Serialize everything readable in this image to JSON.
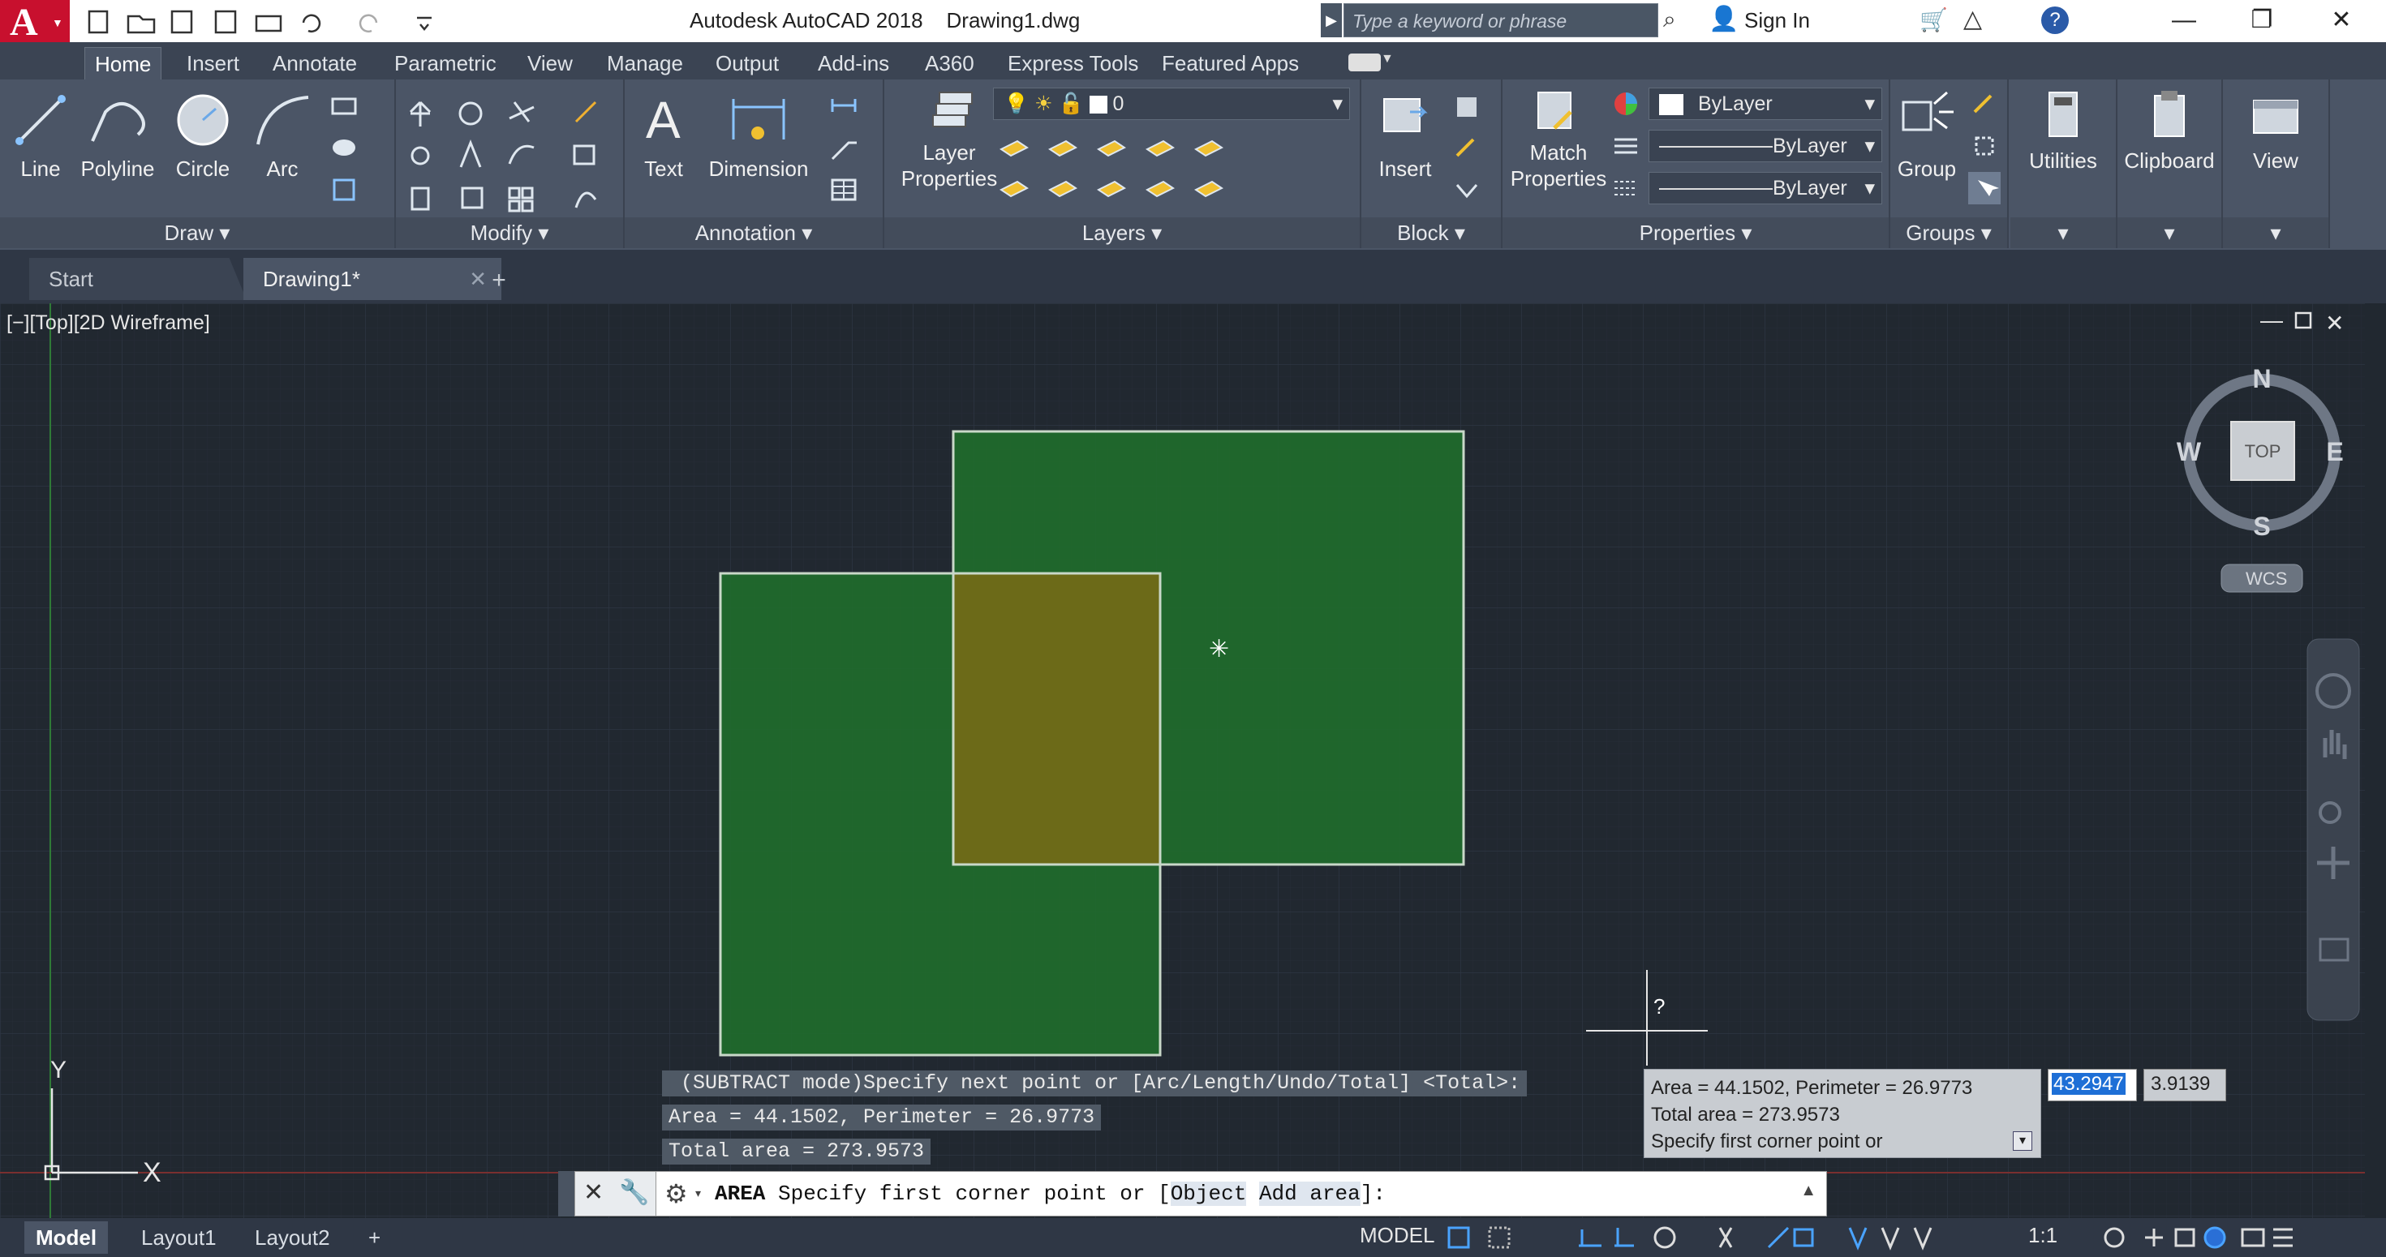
{
  "app": {
    "logo_letter": "A",
    "title": "Autodesk AutoCAD 2018    Drawing1.dwg",
    "search_placeholder": "Type a keyword or phrase",
    "sign_in": "Sign In"
  },
  "ribbon_tabs": [
    "Home",
    "Insert",
    "Annotate",
    "Parametric",
    "View",
    "Manage",
    "Output",
    "Add-ins",
    "A360",
    "Express Tools",
    "Featured Apps"
  ],
  "draw_panel": {
    "label": "Draw",
    "line": "Line",
    "polyline": "Polyline",
    "circle": "Circle",
    "arc": "Arc"
  },
  "modify_panel": {
    "label": "Modify"
  },
  "annotation_panel": {
    "label": "Annotation",
    "text": "Text",
    "dimension": "Dimension"
  },
  "layers_panel": {
    "label": "Layers",
    "layer_properties": "Layer\nProperties",
    "current_layer": "0"
  },
  "block_panel": {
    "label": "Block",
    "insert": "Insert"
  },
  "properties_panel": {
    "label": "Properties",
    "match": "Match\nProperties",
    "color": "ByLayer",
    "linetype": "ByLayer",
    "lineweight": "ByLayer"
  },
  "groups_panel": {
    "label": "Groups",
    "group": "Group"
  },
  "utilities": "Utilities",
  "clipboard": "Clipboard",
  "view_btn": "View",
  "file_tabs": [
    "Start",
    "Drawing1*"
  ],
  "viewport_label": "[−][Top][2D Wireframe]",
  "viewcube": {
    "n": "N",
    "s": "S",
    "e": "E",
    "w": "W",
    "face": "TOP",
    "wcs": "WCS"
  },
  "ucs": {
    "x": "X",
    "y": "Y"
  },
  "command_history": [
    " (SUBTRACT mode)Specify next point or [Arc/Length/Undo/Total] <Total>:",
    "Area = 44.1502, Perimeter = 26.9773",
    "Total area = 273.9573"
  ],
  "command_line": {
    "prefix": "AREA",
    "text": " Specify first corner point or [",
    "opt1": "Object",
    "opt2": "Add area",
    "suffix": "]:"
  },
  "tooltip": {
    "line1": "Area = 44.1502, Perimeter = 26.9773",
    "line2": "Total area = 273.9573",
    "line3": "Specify first corner point or",
    "input_x": "43.2947",
    "input_y": "3.9139"
  },
  "cursor_mark": "?",
  "layout_tabs": [
    "Model",
    "Layout1",
    "Layout2"
  ],
  "status": {
    "model": "MODEL",
    "scale": "1:1"
  },
  "colors": {
    "accent_red": "#c8102e",
    "fill_green": "#1f6b2c",
    "overlap": "#6c6a18",
    "highlight": "#1e6fd6"
  }
}
